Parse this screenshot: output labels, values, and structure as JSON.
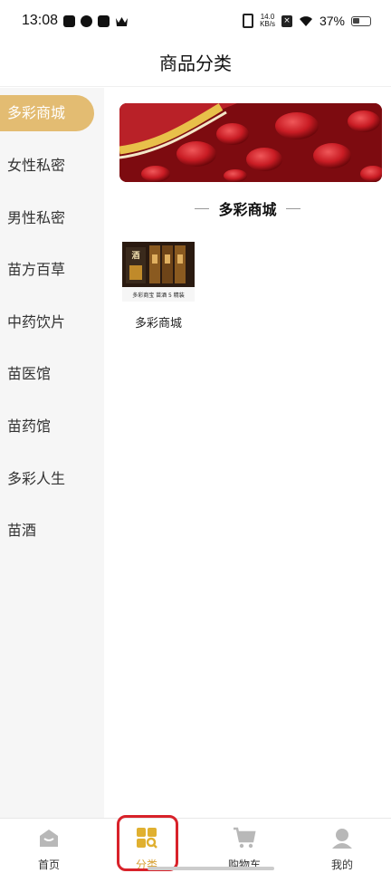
{
  "status_bar": {
    "time": "13:08",
    "net_speed_value": "14.0",
    "net_speed_unit": "KB/s",
    "battery": "37%"
  },
  "header": {
    "title": "商品分类"
  },
  "sidebar": {
    "items": [
      {
        "label": "多彩商城",
        "active": true
      },
      {
        "label": "女性私密"
      },
      {
        "label": "男性私密"
      },
      {
        "label": "苗方百草"
      },
      {
        "label": "中药饮片"
      },
      {
        "label": "苗医馆"
      },
      {
        "label": "苗药馆"
      },
      {
        "label": "多彩人生"
      },
      {
        "label": "苗酒"
      }
    ]
  },
  "main": {
    "section_title": "多彩商城",
    "products": [
      {
        "name": "多彩商城",
        "thumb_caption": "多彩商宝 苗酒 5 精装"
      }
    ]
  },
  "bottom_nav": {
    "items": [
      {
        "label": "首页"
      },
      {
        "label": "分类",
        "active": true
      },
      {
        "label": "购物车"
      },
      {
        "label": "我的"
      }
    ]
  },
  "colors": {
    "accent": "#e3bc72",
    "active_nav": "#d8a134",
    "highlight": "#d8222a"
  }
}
